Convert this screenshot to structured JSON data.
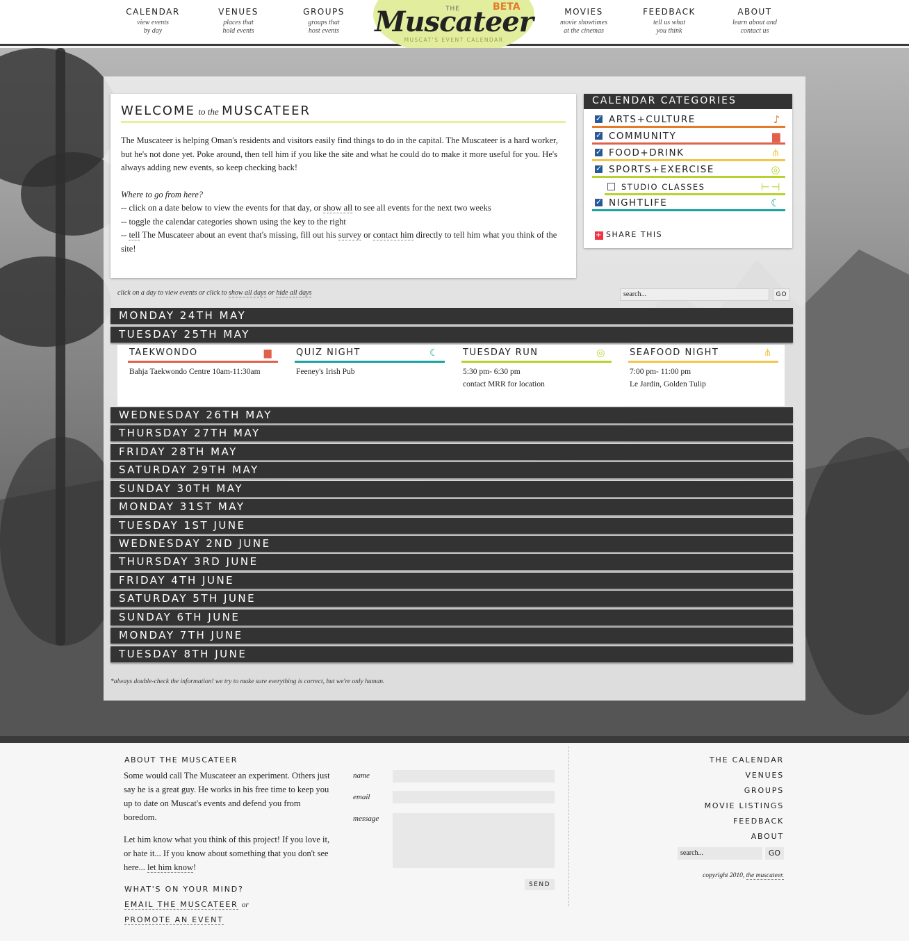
{
  "colors": {
    "arts": "#e57a2a",
    "community": "#e0604a",
    "food": "#f2c64a",
    "sports": "#b8d12e",
    "studio": "#b8d12e",
    "nightlife": "#1aa3a3"
  },
  "nav": {
    "left": [
      {
        "title": "CALENDAR",
        "sub": "view events\nby day"
      },
      {
        "title": "VENUES",
        "sub": "places that\nhold events"
      },
      {
        "title": "GROUPS",
        "sub": "groups that\nhost events"
      }
    ],
    "right": [
      {
        "title": "MOVIES",
        "sub": "movie showtimes\nat the cinemas"
      },
      {
        "title": "FEEDBACK",
        "sub": "tell us what\nyou think"
      },
      {
        "title": "ABOUT",
        "sub": "learn about and\ncontact us"
      }
    ]
  },
  "logo": {
    "the": "THE",
    "beta": "BETA",
    "name": "Muscateer",
    "tagline": "MUSCAT'S EVENT CALENDAR"
  },
  "welcome": {
    "title_a": "WELCOME",
    "title_b": "to the",
    "title_c": "MUSCATEER",
    "intro": "The Muscateer is helping Oman's residents and visitors easily find things to do in the capital. The Muscateer is a hard worker, but he's not done yet. Poke around, then tell him if you like the site and what he could do to make it more useful for you. He's always adding new events, so keep checking back!",
    "where": "Where to go from here?",
    "l1a": "-- click on a date below to view the events for that day, or ",
    "l1b": "show all",
    "l1c": " to see all events for the next two weeks",
    "l2a": "-- toggle the calendar categories shown using the key to the right",
    "l3a": "-- ",
    "l3b": "tell",
    "l3c": " The Muscateer about an event that's missing, fill out his ",
    "l3d": "survey",
    "l3e": " or ",
    "l3f": "contact him",
    "l3g": " directly to tell him what you think of the site!"
  },
  "categories": {
    "title": "CALENDAR CATEGORIES",
    "items": [
      {
        "label": "ARTS+CULTURE",
        "checked": true,
        "icon": "trumpet-icon"
      },
      {
        "label": "COMMUNITY",
        "checked": true,
        "icon": "sofa-icon"
      },
      {
        "label": "FOOD+DRINK",
        "checked": true,
        "icon": "utensils-icon"
      },
      {
        "label": "SPORTS+EXERCISE",
        "checked": true,
        "icon": "tennis-icon"
      },
      {
        "label": "STUDIO CLASSES",
        "checked": false,
        "icon": "dumbbell-icon"
      },
      {
        "label": "NIGHTLIFE",
        "checked": true,
        "icon": "moon-icon"
      }
    ],
    "share": "SHARE THIS"
  },
  "list": {
    "hint_a": "click on a day to view events or click to ",
    "hint_b": "show all days",
    "hint_c": " or ",
    "hint_d": "hide all days",
    "search_placeholder": "search...",
    "go": "GO"
  },
  "days": [
    "MONDAY 24TH MAY",
    "TUESDAY 25TH MAY",
    "WEDNESDAY 26TH MAY",
    "THURSDAY 27TH MAY",
    "FRIDAY 28TH MAY",
    "SATURDAY 29TH MAY",
    "SUNDAY 30TH MAY",
    "MONDAY 31ST MAY",
    "TUESDAY 1ST JUNE",
    "WEDNESDAY 2ND JUNE",
    "THURSDAY 3RD JUNE",
    "FRIDAY 4TH JUNE",
    "SATURDAY 5TH JUNE",
    "SUNDAY 6TH JUNE",
    "MONDAY 7TH JUNE",
    "TUESDAY 8TH JUNE"
  ],
  "events": [
    {
      "title": "TAEKWONDO",
      "detail": "Bahja Taekwondo Centre  10am-11:30am",
      "category": "community",
      "icon": "sofa-icon"
    },
    {
      "title": "QUIZ NIGHT",
      "detail": "Feeney's Irish Pub",
      "category": "nightlife",
      "icon": "moon-icon"
    },
    {
      "title": "TUESDAY RUN",
      "detail": "5:30 pm-  6:30 pm\ncontact MRR for location",
      "category": "sports",
      "icon": "tennis-icon"
    },
    {
      "title": "SEAFOOD NIGHT",
      "detail": "7:00 pm-  11:00 pm\nLe Jardin, Golden Tulip",
      "category": "food",
      "icon": "utensils-icon"
    }
  ],
  "note": "*always double-check the information! we try to make sure everything is correct, but we're only human.",
  "footer": {
    "about_title": "ABOUT THE MUSCATEER",
    "about_p1": "Some would call The Muscateer an experiment. Others just say he is a great guy. He works in his free time to keep you up to date on Muscat's events and defend you from boredom.",
    "about_p2a": "Let him know what you think of this project! If you love it, or hate it... If you know about something that you don't see here... ",
    "about_p2b": "let him know",
    "about_p2c": "!",
    "mind": "WHAT'S ON YOUR MIND?",
    "email": "EMAIL THE MUSCATEER",
    "or": "or",
    "promote": "PROMOTE AN EVENT",
    "name_label": "name",
    "email_label": "email",
    "message_label": "message",
    "send": "SEND",
    "links": [
      "THE CALENDAR",
      "VENUES",
      "GROUPS",
      "MOVIE LISTINGS",
      "FEEDBACK",
      "ABOUT"
    ],
    "search_placeholder": "search...",
    "go": "GO",
    "copyright_a": "copyright 2010, ",
    "copyright_b": "the muscateer."
  }
}
